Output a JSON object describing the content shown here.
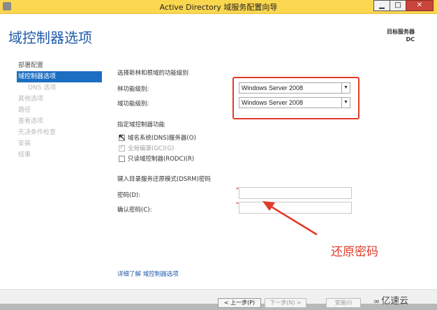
{
  "window": {
    "title": "Active Directory 域服务配置向导"
  },
  "header": {
    "page_title": "域控制器选项",
    "target_label": "目标服务器",
    "target_value": "DC"
  },
  "nav": {
    "items": [
      {
        "label": "部署配置",
        "state": "normal"
      },
      {
        "label": "域控制器选项",
        "state": "active"
      },
      {
        "label": "DNS 选项",
        "state": "disabled"
      },
      {
        "label": "其他选项",
        "state": "disabled"
      },
      {
        "label": "路径",
        "state": "disabled"
      },
      {
        "label": "查看选项",
        "state": "disabled"
      },
      {
        "label": "先决条件检查",
        "state": "disabled"
      },
      {
        "label": "安装",
        "state": "disabled"
      },
      {
        "label": "结果",
        "state": "disabled"
      }
    ]
  },
  "functional_level": {
    "section_label": "选择新林和根域的功能级别",
    "forest_label": "林功能级别:",
    "forest_value": "Windows Server 2008",
    "domain_label": "域功能级别:",
    "domain_value": "Windows Server 2008"
  },
  "capabilities": {
    "section_label": "指定域控制器功能",
    "dns": {
      "label": "域名系统(DNS)服务器(O)",
      "checked": true
    },
    "gc": {
      "label": "全局编录(GC)(G)",
      "checked": true
    },
    "rodc": {
      "label": "只读域控制器(RODC)(R)",
      "checked": false
    }
  },
  "dsrm": {
    "section_label": "键入目录服务还原模式(DSRM)密码",
    "password_label": "密码(D):",
    "confirm_label": "确认密码(C):",
    "required_mark": "*"
  },
  "annotation": {
    "text": "还原密码",
    "color": "#e23a2a"
  },
  "more_link": "详细了解 域控制器选项",
  "footer": {
    "prev": "< 上一步(P)",
    "next": "下一步(N) >",
    "install": "安装(I)"
  },
  "watermark": {
    "text": "亿速云"
  },
  "colors": {
    "titlebar": "#fbd64f",
    "accent": "#1f5aa8",
    "nav_active": "#1c6ec2",
    "highlight": "#e23a2a"
  }
}
